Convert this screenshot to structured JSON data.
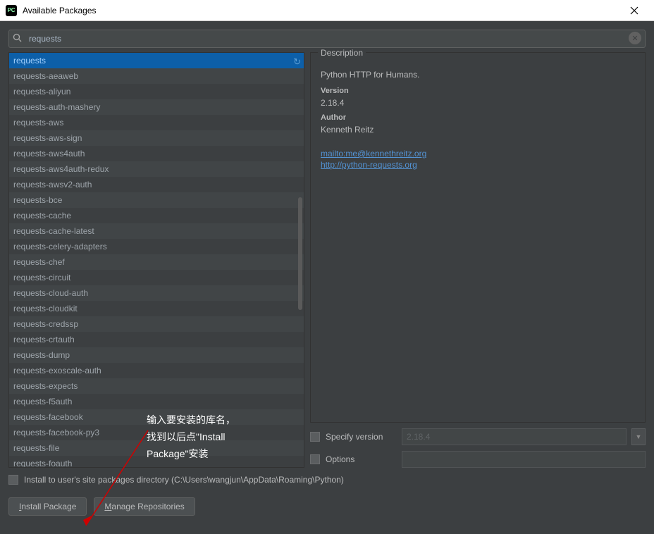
{
  "window": {
    "title": "Available Packages"
  },
  "search": {
    "value": "requests",
    "placeholder": ""
  },
  "packages": [
    "requests",
    "requests-aeaweb",
    "requests-aliyun",
    "requests-auth-mashery",
    "requests-aws",
    "requests-aws-sign",
    "requests-aws4auth",
    "requests-aws4auth-redux",
    "requests-awsv2-auth",
    "requests-bce",
    "requests-cache",
    "requests-cache-latest",
    "requests-celery-adapters",
    "requests-chef",
    "requests-circuit",
    "requests-cloud-auth",
    "requests-cloudkit",
    "requests-credssp",
    "requests-crtauth",
    "requests-dump",
    "requests-exoscale-auth",
    "requests-expects",
    "requests-f5auth",
    "requests-facebook",
    "requests-facebook-py3",
    "requests-file",
    "requests-foauth"
  ],
  "selected_index": 0,
  "description": {
    "legend": "Description",
    "summary": "Python HTTP for Humans.",
    "version_label": "Version",
    "version": "2.18.4",
    "author_label": "Author",
    "author": "Kenneth Reitz",
    "links": [
      "mailto:me@kennethreitz.org",
      "http://python-requests.org"
    ]
  },
  "options": {
    "specify_version_label": "Specify version",
    "specify_version_value": "2.18.4",
    "options_label": "Options",
    "options_value": ""
  },
  "footer": {
    "install_to_user_label": "Install to user's site packages directory (C:\\Users\\wangjun\\AppData\\Roaming\\Python)",
    "install_button": "Install Package",
    "manage_button": "Manage Repositories"
  },
  "annotation": {
    "line1": "输入要安装的库名，",
    "line2": "找到以后点\"Install",
    "line3": "Package\"安装"
  }
}
